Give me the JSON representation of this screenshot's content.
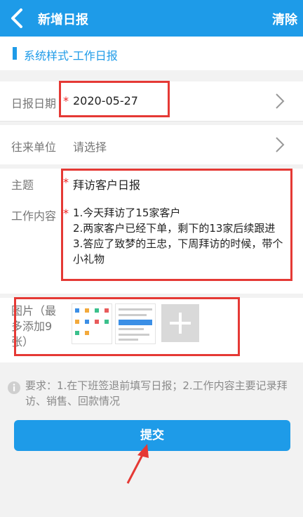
{
  "header": {
    "title": "新增日报",
    "clear_label": "清除"
  },
  "section": {
    "title": "系统样式-工作日报"
  },
  "form": {
    "date": {
      "label": "日报日期",
      "value": "2020-05-27",
      "required_mark": "*"
    },
    "unit": {
      "label": "往来单位",
      "placeholder": "请选择"
    },
    "subject": {
      "label": "主题",
      "value": "拜访客户日报",
      "required_mark": "*"
    },
    "content": {
      "label": "工作内容",
      "required_mark": "*",
      "lines": [
        "1.今天拜访了15家客户",
        "2.两家客户已经下单，剩下的13家后续跟进",
        "3.答应了致梦的王忠，下周拜访的时候，带个小礼物"
      ]
    },
    "images": {
      "label": "图片（最多添加9张）"
    }
  },
  "hint": {
    "text": "要求：1.在下班签退前填写日报；2.工作内容主要记录拜访、销售、回款情况"
  },
  "submit": {
    "label": "提交"
  },
  "colors": {
    "primary": "#1e9be8",
    "annotation_red": "#e53935",
    "required": "#e22222"
  },
  "icons": [
    "back-arrow-icon",
    "chevron-right-icon",
    "info-icon",
    "plus-icon"
  ]
}
